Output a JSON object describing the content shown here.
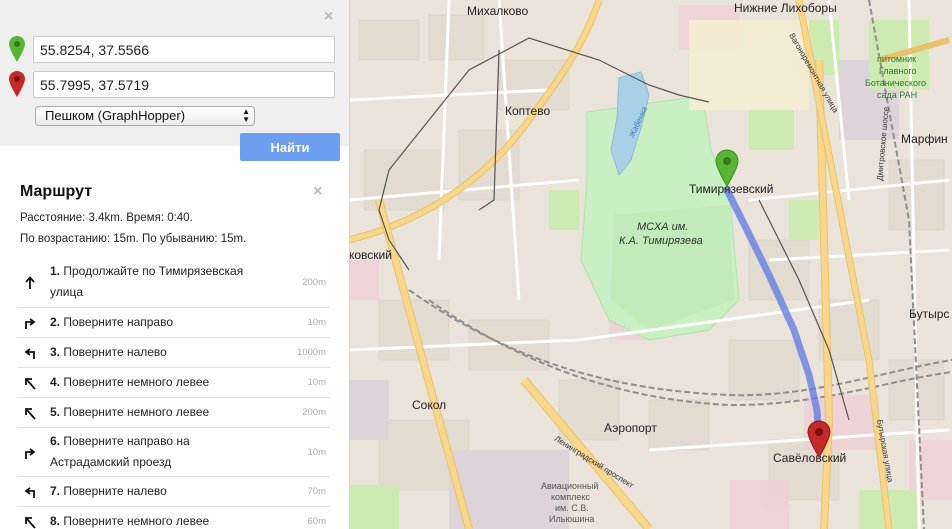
{
  "search": {
    "start_value": "55.8254, 37.5566",
    "end_value": "55.7995, 37.5719",
    "mode_selected": "Пешком (GraphHopper)",
    "find_label": "Найти",
    "close_glyph": "×"
  },
  "route": {
    "title": "Маршрут",
    "close_glyph": "×",
    "summary": "Расстояние: 3.4km. Время: 0:40.",
    "elevation": "По возрастанию: 15m. По убыванию: 15m.",
    "steps": [
      {
        "num": "1.",
        "text": "Продолжайте по Тимирязевская улица",
        "dist": "200m",
        "icon": "straight-arrow-icon"
      },
      {
        "num": "2.",
        "text": "Поверните направо",
        "dist": "10m",
        "icon": "turn-right-icon"
      },
      {
        "num": "3.",
        "text": "Поверните налево",
        "dist": "1000m",
        "icon": "turn-left-icon"
      },
      {
        "num": "4.",
        "text": "Поверните немного левее",
        "dist": "10m",
        "icon": "slight-left-icon"
      },
      {
        "num": "5.",
        "text": "Поверните немного левее",
        "dist": "200m",
        "icon": "slight-left-icon"
      },
      {
        "num": "6.",
        "text": "Поверните направо на Астрадамский проезд",
        "dist": "10m",
        "icon": "turn-right-icon"
      },
      {
        "num": "7.",
        "text": "Поверните налево",
        "dist": "70m",
        "icon": "turn-left-icon"
      },
      {
        "num": "8.",
        "text": "Поверните немного левее",
        "dist": "60m",
        "icon": "slight-left-icon"
      }
    ]
  },
  "map": {
    "labels": {
      "mikhalkovo": "Михалково",
      "nizhnie_likhobory": "Нижние Лихоборы",
      "koptevo": "Коптево",
      "timiryazevsky": "Тимирязевский",
      "mskha_1": "МСХА им.",
      "mskha_2": "К.А. Тимирязева",
      "koptevsky": "ковский",
      "sokol": "Сокол",
      "aeroport": "Аэропорт",
      "savelovsky": "Савёловский",
      "marfino": "Марфин",
      "butyrsky": "Бутырс",
      "pitomnik_1": "питомник",
      "pitomnik_2": "Главного",
      "pitomnik_3": "Ботанического",
      "pitomnik_4": "сада РАН",
      "aviakompleks_1": "Авиационный",
      "aviakompleks_2": "комплекс",
      "aviakompleks_3": "им. С.В.",
      "aviakompleks_4": "Ильюшина",
      "zhabenka": "Жабенка",
      "dmitrovskoe": "Дмитровское шоссе",
      "vagonoremontnaya": "Вагоноремонтная улица",
      "leningradsky": "Ленинградский проспект",
      "butyrskaya": "Бутырская улица"
    },
    "colors": {
      "route": "#5b78e8",
      "start_pin": "#57b534",
      "end_pin": "#c42a2a",
      "park": "#c8f0c2",
      "major_road": "#f8d78a"
    }
  }
}
